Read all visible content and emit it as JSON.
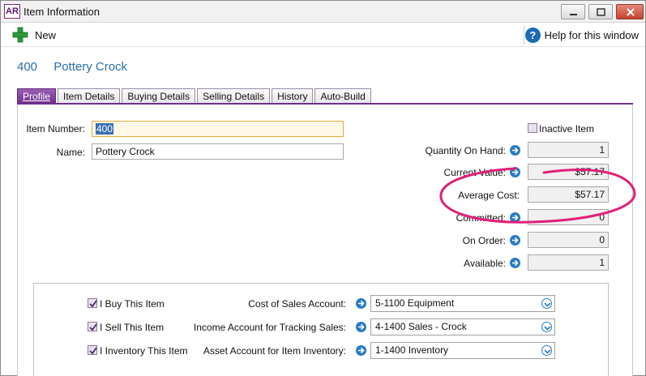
{
  "window": {
    "logo": "AR",
    "title": "Item Information"
  },
  "toolbar": {
    "new_label": "New",
    "help_label": "Help for this window"
  },
  "heading": {
    "item_number": "400",
    "item_name": "Pottery Crock"
  },
  "tabs": [
    {
      "label": "Profile",
      "active": true
    },
    {
      "label": "Item Details"
    },
    {
      "label": "Buying Details"
    },
    {
      "label": "Selling Details"
    },
    {
      "label": "History"
    },
    {
      "label": "Auto-Build"
    }
  ],
  "profile": {
    "item_number_label": "Item Number:",
    "item_number_value": "400",
    "name_label": "Name:",
    "name_value": "Pottery Crock",
    "inactive_label": "Inactive Item",
    "inactive_checked": false
  },
  "stats": {
    "qty_label": "Quantity On Hand:",
    "qty_value": "1",
    "current_value_label": "Current Value:",
    "current_value": "$57.17",
    "avg_cost_label": "Average Cost:",
    "avg_cost_value": "$57.17",
    "committed_label": "Committed:",
    "committed_value": "0",
    "on_order_label": "On Order:",
    "on_order_value": "0",
    "available_label": "Available:",
    "available_value": "1"
  },
  "accounts": {
    "buy_label": "I Buy This Item",
    "buy_checked": true,
    "sell_label": "I Sell This Item",
    "sell_checked": true,
    "inventory_label": "I Inventory This Item",
    "inventory_checked": true,
    "cost_of_sales_label": "Cost of Sales Account:",
    "cost_of_sales_value": "5-1100 Equipment",
    "income_label": "Income Account for Tracking Sales:",
    "income_value": "4-1400 Sales - Crock",
    "asset_label": "Asset Account for Item Inventory:",
    "asset_value": "1-1400 Inventory"
  },
  "colors": {
    "accent_purple": "#6e2f8c",
    "link_blue": "#2a6fa8",
    "annotation_pink": "#e0207a"
  }
}
